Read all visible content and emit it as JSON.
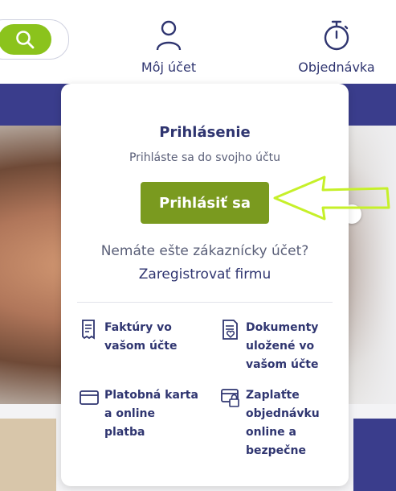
{
  "header": {
    "account_label": "Môj účet",
    "order_label": "Objednávka"
  },
  "login_panel": {
    "title": "Prihlásenie",
    "subtitle": "Prihláste sa do svojho účtu",
    "login_button": "Prihlásiť sa",
    "no_account_text": "Nemáte ešte zákaznícky účet?",
    "register_link": "Zaregistrovať firmu"
  },
  "features": [
    {
      "label": "Faktúry vo vašom účte",
      "icon": "invoice-icon"
    },
    {
      "label": "Dokumenty uložené vo vašom účte",
      "icon": "document-heart-icon"
    },
    {
      "label": "Platobná karta a online platba",
      "icon": "credit-card-icon"
    },
    {
      "label": "Zaplaťte objednávku online a bezpečne",
      "icon": "secure-payment-icon"
    }
  ],
  "colors": {
    "primary": "#2f3570",
    "login_button": "#7a9a1f",
    "search_button": "#8bc31c",
    "highlight_arrow": "#c6f02a"
  }
}
